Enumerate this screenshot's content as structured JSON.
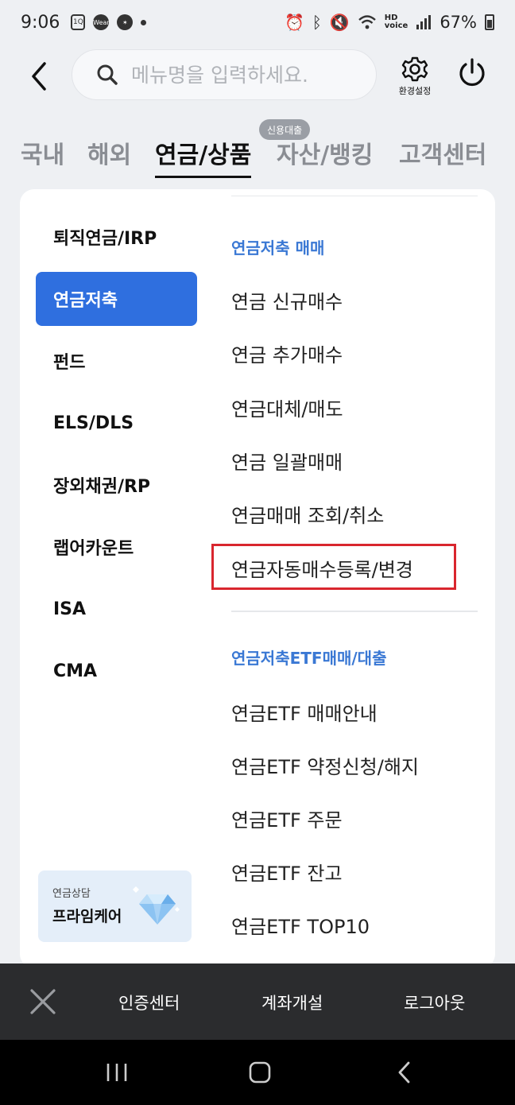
{
  "status_bar": {
    "time": "9:06",
    "battery": "67%",
    "left_icons": [
      "1Q",
      "Wear"
    ]
  },
  "header": {
    "search_placeholder": "메뉴명을 입력하세요.",
    "settings_label": "환경설정"
  },
  "tabs": {
    "items": [
      "국내",
      "해외",
      "연금/상품",
      "자산/뱅킹",
      "고객센터"
    ],
    "active": "연금/상품",
    "badge": "신용대출"
  },
  "left_menu": {
    "items": [
      "퇴직연금/IRP",
      "연금저축",
      "펀드",
      "ELS/DLS",
      "장외채권/RP",
      "랩어카운트",
      "ISA",
      "CMA"
    ],
    "active": "연금저축"
  },
  "promo": {
    "subtitle": "연금상담",
    "title": "프라임케어"
  },
  "right_menu": {
    "section1": {
      "title": "연금저축 매매",
      "items": [
        "연금 신규매수",
        "연금 추가매수",
        "연금대체/매도",
        "연금 일괄매매",
        "연금매매 조회/취소",
        "연금자동매수등록/변경"
      ]
    },
    "section2": {
      "title": "연금저축ETF매매/대출",
      "items": [
        "연금ETF 매매안내",
        "연금ETF 약정신청/해지",
        "연금ETF 주문",
        "연금ETF 잔고",
        "연금ETF TOP10"
      ]
    },
    "highlighted": "연금자동매수등록/변경"
  },
  "bottom_bar": {
    "items": [
      "인증센터",
      "계좌개설",
      "로그아웃"
    ]
  },
  "colors": {
    "accent": "#2f6fdf",
    "section_title": "#3a78d4",
    "highlight_border": "#d9262e",
    "bottom_bar": "#2b2c2e"
  }
}
